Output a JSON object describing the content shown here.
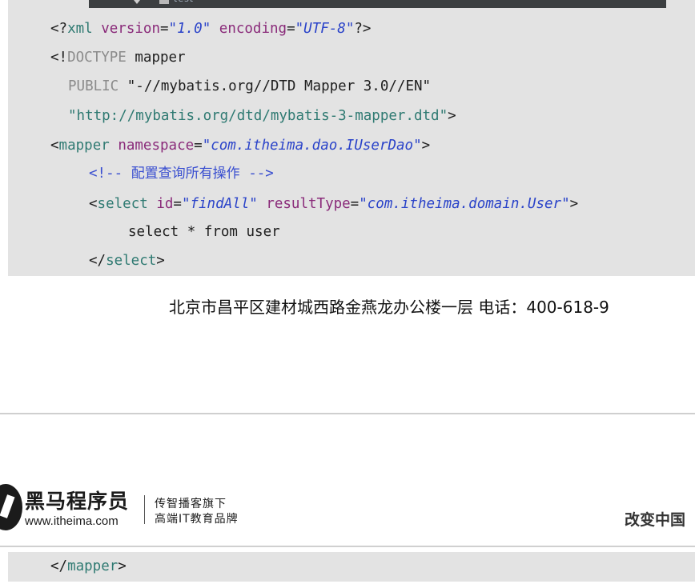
{
  "top_image": {
    "file_label": "test"
  },
  "code": {
    "line1": {
      "open": "<?",
      "tag": "xml",
      "sp1": " ",
      "attr1": "version",
      "eq1": "=",
      "val1": "\"1.0\"",
      "sp2": " ",
      "attr2": "encoding",
      "eq2": "=",
      "val2": "\"UTF-8\"",
      "close": "?>"
    },
    "line2": {
      "open": "<!",
      "keyword": "DOCTYPE",
      "rest": " mapper"
    },
    "line3": {
      "keyword": "PUBLIC",
      "rest": " \"-//mybatis.org//DTD Mapper 3.0//EN\""
    },
    "line4": {
      "str": "\"http://mybatis.org/dtd/mybatis-3-mapper.dtd\"",
      "close": ">"
    },
    "line5": {
      "open": "<",
      "tag": "mapper",
      "sp": " ",
      "attr": "namespace",
      "eq": "=",
      "val": "\"com.itheima.dao.IUserDao\"",
      "close": ">"
    },
    "line6": {
      "c_open": "<!-- ",
      "text": "配置查询所有操作",
      "c_close": " -->"
    },
    "line7": {
      "open": "<",
      "tag": "select",
      "sp1": " ",
      "attr1": "id",
      "eq1": "=",
      "val1": "\"findAll\"",
      "sp2": " ",
      "attr2": "resultType",
      "eq2": "=",
      "val2": "\"com.itheima.domain.User\"",
      "close": ">"
    },
    "line8": {
      "text": "select * from user"
    },
    "line9": {
      "open": "</",
      "tag": "select",
      "close": ">"
    }
  },
  "footer": {
    "address": "北京市昌平区建材城西路金燕龙办公楼一层    电话：400-618-9"
  },
  "header2": {
    "brand_name": "黑马程序员",
    "brand_url": "www.itheima.com",
    "slogan_line1": "传智播客旗下",
    "slogan_line2": "高端IT教育品牌",
    "slogan_right": "改变中国"
  },
  "code2": {
    "line1": {
      "open": "</",
      "tag": "mapper",
      "close": ">"
    }
  },
  "colors": {
    "code_bg": "#e3e3e3",
    "tag": "#2f7a72",
    "attribute": "#8a2b7a",
    "string": "#2a43c9",
    "comment": "#3a4fd0"
  }
}
